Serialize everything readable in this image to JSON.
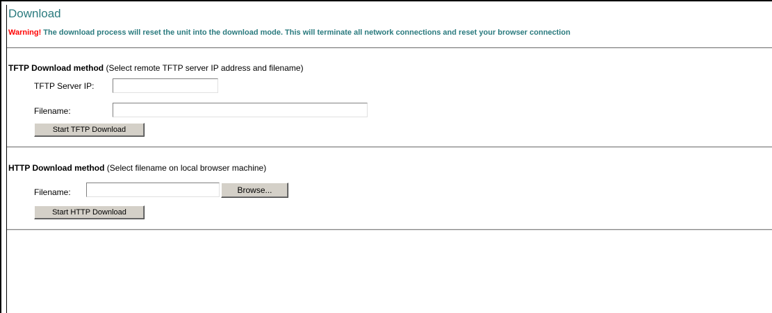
{
  "page": {
    "title": "Download",
    "warning_word": "Warning!",
    "warning_text": " The download process will reset the unit into the download mode. This will terminate all network connections and reset your browser connection"
  },
  "tftp": {
    "heading_bold": "TFTP Download method",
    "heading_note": " (Select remote TFTP server IP address and filename)",
    "server_ip_label": "TFTP Server IP:",
    "server_ip_value": "",
    "filename_label": "Filename:",
    "filename_value": "",
    "start_button": "Start TFTP Download"
  },
  "http": {
    "heading_bold": "HTTP Download method",
    "heading_note": " (Select filename on local browser machine)",
    "filename_label": "Filename:",
    "filename_value": "",
    "browse_button": "Browse...",
    "start_button": "Start HTTP Download"
  },
  "colors": {
    "title": "#2a7a7e",
    "warning_word": "#ff0000",
    "warning_text": "#2a7a7e",
    "button_face": "#d4d0c8"
  }
}
